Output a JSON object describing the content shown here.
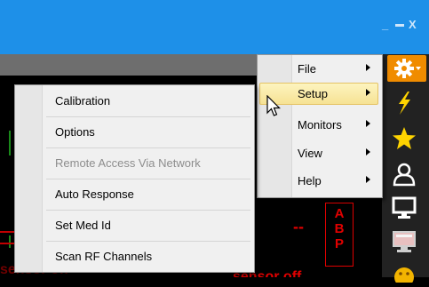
{
  "window": {
    "minimize_glyph": "_",
    "maximize_glyph": "▬",
    "close_glyph": "X",
    "accent_color": "#1e90e8"
  },
  "monitor": {
    "sensor_text_left": "sensor off",
    "sensor_text_right": "sensor off",
    "dash_text": "--",
    "abp_letters": [
      "A",
      "B",
      "P"
    ],
    "alarm_color": "#e00000"
  },
  "toolbar": {
    "buttons": [
      {
        "name": "gear-icon",
        "active": true
      },
      {
        "name": "lightning-icon",
        "active": false
      },
      {
        "name": "star-icon",
        "active": false
      },
      {
        "name": "person-icon",
        "active": false
      },
      {
        "name": "monitor-icon",
        "active": false
      },
      {
        "name": "display-icon",
        "active": false
      },
      {
        "name": "smiley-icon",
        "active": false
      }
    ],
    "active_color": "#f08c00"
  },
  "main_menu": {
    "items": [
      {
        "label": "File",
        "has_submenu": true,
        "highlighted": false
      },
      {
        "label": "Setup",
        "has_submenu": true,
        "highlighted": true
      },
      {
        "label": "Monitors",
        "has_submenu": true,
        "highlighted": false
      },
      {
        "label": "View",
        "has_submenu": true,
        "highlighted": false
      },
      {
        "label": "Help",
        "has_submenu": true,
        "highlighted": false
      }
    ]
  },
  "setup_submenu": {
    "items": [
      {
        "label": "Calibration",
        "enabled": true
      },
      {
        "label": "Options",
        "enabled": true
      },
      {
        "label": "Remote Access Via Network",
        "enabled": false
      },
      {
        "label": "Auto Response",
        "enabled": true
      },
      {
        "label": "Set Med Id",
        "enabled": true
      },
      {
        "label": "Scan RF Channels",
        "enabled": true
      }
    ]
  }
}
